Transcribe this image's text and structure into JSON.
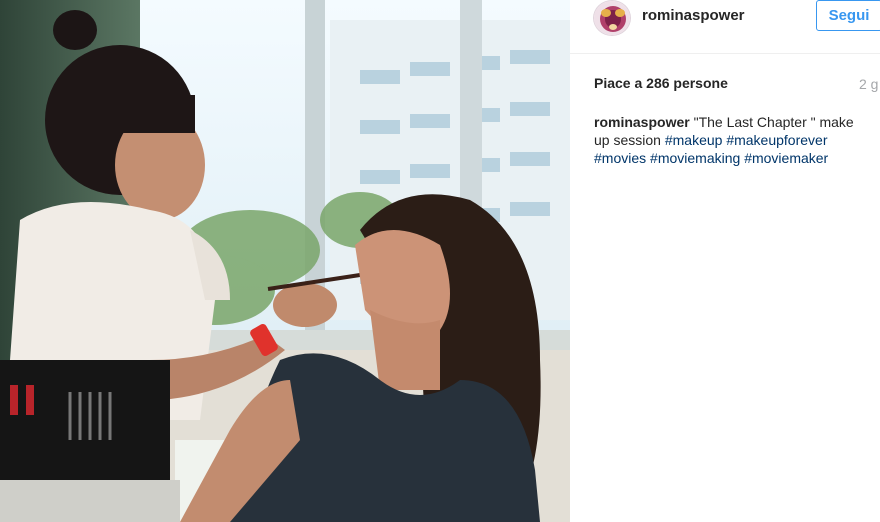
{
  "post": {
    "username": "rominaspower",
    "follow_label": "Segui",
    "likes_text": "Piace a 286 persone",
    "time_ago": "2 g",
    "caption": {
      "username": "rominaspower",
      "text_part1": " \"The Last Chapter \" make up session ",
      "hashtags": [
        "#makeup",
        "#makeupforever",
        "#movies",
        "#moviemaking",
        "#moviemaker"
      ]
    }
  },
  "colors": {
    "follow_blue": "#3897f0",
    "hashtag_blue": "#003569",
    "muted_gray": "#a5a7aa",
    "text_dark": "#262626"
  }
}
